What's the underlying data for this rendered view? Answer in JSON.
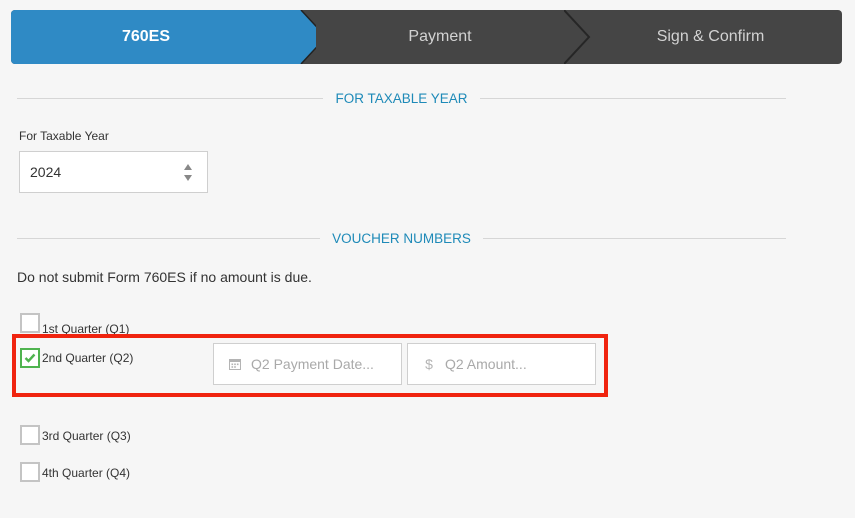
{
  "stepper": {
    "steps": [
      {
        "label": "760ES",
        "active": true
      },
      {
        "label": "Payment",
        "active": false
      },
      {
        "label": "Sign & Confirm",
        "active": false
      }
    ]
  },
  "taxable_year_section": {
    "title": "FOR TAXABLE YEAR",
    "field_label": "For Taxable Year",
    "selected_year": "2024"
  },
  "voucher_section": {
    "title": "VOUCHER NUMBERS",
    "note": "Do not submit Form 760ES if no amount is due.",
    "quarters": [
      {
        "label": "1st Quarter (Q1)",
        "checked": false
      },
      {
        "label": "2nd Quarter (Q2)",
        "checked": true
      },
      {
        "label": "3rd Quarter (Q3)",
        "checked": false
      },
      {
        "label": "4th Quarter (Q4)",
        "checked": false
      }
    ],
    "q2_fields": {
      "date_placeholder": "Q2 Payment Date...",
      "date_icon": "calendar-icon",
      "amount_placeholder": "Q2 Amount...",
      "amount_icon": "dollar-icon",
      "amount_symbol": "$"
    }
  },
  "colors": {
    "active_step": "#2f8ac5",
    "inactive_step": "#454545",
    "section_title": "#1e8ab8",
    "checked_border": "#4fb34f",
    "highlight": "#f0240f"
  }
}
